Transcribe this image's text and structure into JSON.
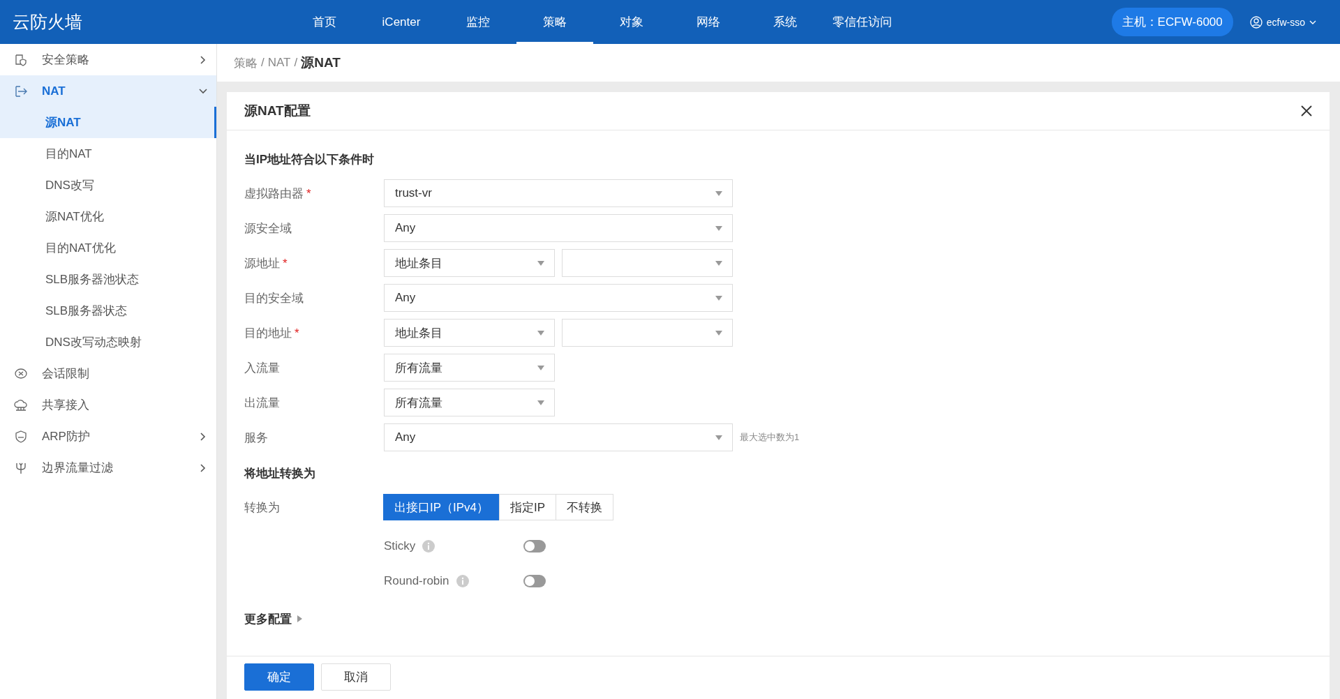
{
  "header": {
    "logo": "云防火墙",
    "nav": [
      {
        "label": "首页",
        "selected": false
      },
      {
        "label": "iCenter",
        "selected": false
      },
      {
        "label": "监控",
        "selected": false
      },
      {
        "label": "策略",
        "selected": true
      },
      {
        "label": "对象",
        "selected": false
      },
      {
        "label": "网络",
        "selected": false
      },
      {
        "label": "系统",
        "selected": false
      },
      {
        "label": "零信任访问",
        "selected": false
      }
    ],
    "host": "主机：ECFW-6000",
    "user": "ecfw-sso"
  },
  "sidebar": {
    "items": [
      {
        "label": "安全策略",
        "kind": "group",
        "expanded": false,
        "selected": false
      },
      {
        "label": "NAT",
        "kind": "group",
        "expanded": true,
        "selected": true,
        "children": [
          {
            "label": "源NAT",
            "selected": true
          },
          {
            "label": "目的NAT",
            "selected": false
          },
          {
            "label": "DNS改写",
            "selected": false
          },
          {
            "label": "源NAT优化",
            "selected": false
          },
          {
            "label": "目的NAT优化",
            "selected": false
          },
          {
            "label": "SLB服务器池状态",
            "selected": false
          },
          {
            "label": "SLB服务器状态",
            "selected": false
          },
          {
            "label": "DNS改写动态映射",
            "selected": false
          }
        ]
      },
      {
        "label": "会话限制",
        "kind": "link",
        "selected": false
      },
      {
        "label": "共享接入",
        "kind": "link",
        "selected": false
      },
      {
        "label": "ARP防护",
        "kind": "group",
        "expanded": false,
        "selected": false
      },
      {
        "label": "边界流量过滤",
        "kind": "group",
        "expanded": false,
        "selected": false
      }
    ]
  },
  "breadcrumb": {
    "separator": "/",
    "items": [
      "策略",
      "NAT",
      "源NAT"
    ]
  },
  "dialog": {
    "title": "源NAT配置",
    "section1": "当IP地址符合以下条件时",
    "fields": [
      {
        "label": "虚拟路由器",
        "required_mark": "*",
        "kind": "wide",
        "values": [
          "trust-vr"
        ]
      },
      {
        "label": "源安全域",
        "kind": "wide",
        "values": [
          "Any"
        ]
      },
      {
        "label": "源地址",
        "required_mark": "*",
        "kind": "pair",
        "values": [
          "地址条目"
        ]
      },
      {
        "label": "目的安全域",
        "kind": "wide",
        "values": [
          "Any"
        ]
      },
      {
        "label": "目的地址",
        "required_mark": "*",
        "kind": "pair",
        "values": [
          "地址条目"
        ]
      },
      {
        "label": "入流量",
        "kind": "half",
        "values": [
          "所有流量"
        ]
      },
      {
        "label": "出流量",
        "kind": "half",
        "values": [
          "所有流量"
        ]
      },
      {
        "label": "服务",
        "kind": "wide",
        "values": [
          "Any"
        ],
        "hint": "最大选中数为1"
      }
    ],
    "section2": "将地址转换为",
    "translate": {
      "label": "转换为",
      "options": [
        {
          "label": "出接口IP（IPv4）",
          "selected": true
        },
        {
          "label": "指定IP",
          "selected": false
        },
        {
          "label": "不转换",
          "selected": false
        }
      ]
    },
    "toggles": [
      {
        "label": "Sticky",
        "on": false
      },
      {
        "label": "Round-robin",
        "on": false
      }
    ],
    "more": "更多配置",
    "buttons": [
      {
        "label": "确定",
        "kind": "primary"
      },
      {
        "label": "取消",
        "kind": "default"
      }
    ]
  }
}
